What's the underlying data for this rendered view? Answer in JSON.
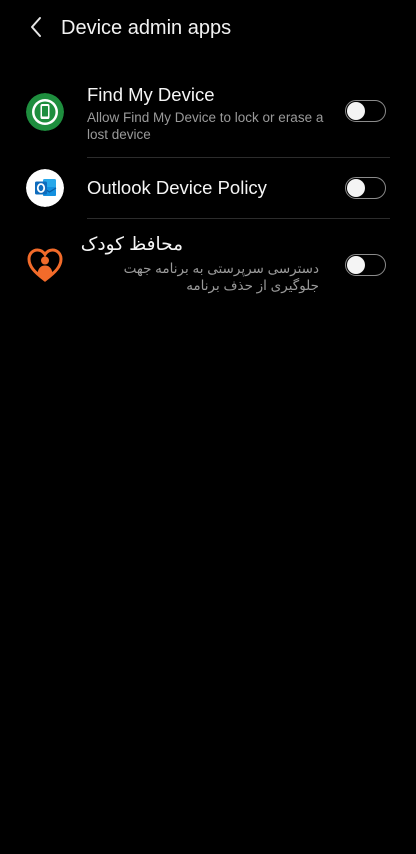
{
  "header": {
    "title": "Device admin apps"
  },
  "apps": [
    {
      "name": "Find My Device",
      "description": "Allow Find My Device to lock or erase a lost device",
      "enabled": false,
      "icon": "find-my-device-icon"
    },
    {
      "name": "Outlook Device Policy",
      "description": "",
      "enabled": false,
      "icon": "outlook-icon"
    },
    {
      "name": "محافظ کودک",
      "description": "دسترسی سرپرستی به برنامه جهت جلوگیری از حذف برنامه",
      "enabled": false,
      "icon": "child-guardian-icon"
    }
  ],
  "colors": {
    "background": "#000000",
    "find_my_device_green": "#1e8e3e",
    "outlook_blue": "#0f6cbd",
    "guardian_orange": "#f26b2a"
  }
}
